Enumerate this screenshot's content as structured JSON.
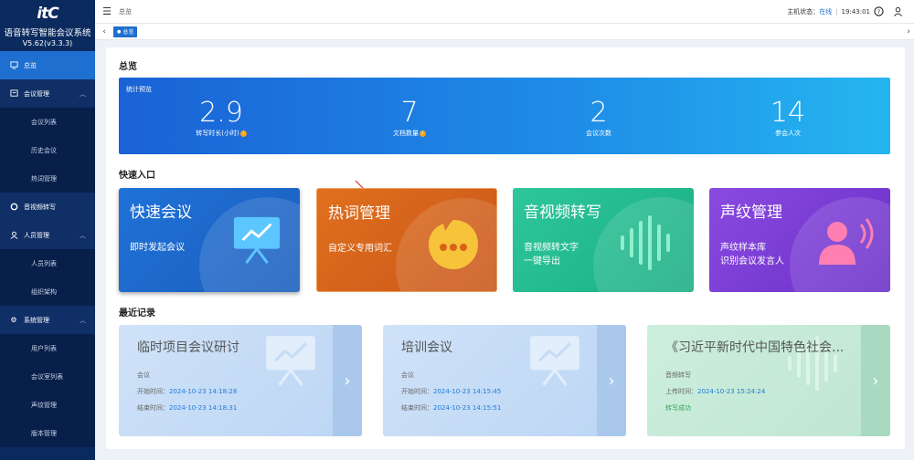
{
  "app": {
    "logo": "itC",
    "title": "语音转写智能会议系统",
    "version": "V5.62(v3.3.3)"
  },
  "sidebar": {
    "items": [
      {
        "label": "总览",
        "icon": "monitor-icon",
        "kind": "active"
      },
      {
        "label": "会议管理",
        "icon": "meeting-icon",
        "kind": "group"
      },
      {
        "label": "会议列表",
        "kind": "sub"
      },
      {
        "label": "历史会议",
        "kind": "sub"
      },
      {
        "label": "热词管理",
        "kind": "sub"
      },
      {
        "label": "音视频转写",
        "icon": "transcribe-icon",
        "kind": "group"
      },
      {
        "label": "人员管理",
        "icon": "user-icon",
        "kind": "group"
      },
      {
        "label": "人员列表",
        "kind": "sub"
      },
      {
        "label": "组织架构",
        "kind": "sub"
      },
      {
        "label": "系统管理",
        "icon": "gear-icon",
        "kind": "group"
      },
      {
        "label": "用户列表",
        "kind": "sub"
      },
      {
        "label": "会议室列表",
        "kind": "sub"
      },
      {
        "label": "声纹管理",
        "kind": "sub"
      },
      {
        "label": "版本管理",
        "kind": "sub"
      }
    ]
  },
  "topbar": {
    "breadcrumb": "总览",
    "status_label": "主机状态：",
    "status_value": "在线",
    "separator": "|",
    "time": "19:43:01"
  },
  "tagbar": {
    "tag": "总览"
  },
  "overview": {
    "title": "总览",
    "stats_label": "统计预览",
    "stats": [
      {
        "value": "2.9",
        "label": "转写时长(小时)"
      },
      {
        "value": "7",
        "label": "文档数量"
      },
      {
        "value": "2",
        "label": "会议次数"
      },
      {
        "value": "14",
        "label": "参会人次"
      }
    ]
  },
  "quick": {
    "title": "快速入口",
    "cards": [
      {
        "title": "快速会议",
        "lines": [
          "即时发起会议"
        ],
        "color": "#1d6fd0"
      },
      {
        "title": "热词管理",
        "lines": [
          "自定义专用词汇"
        ],
        "color": "#d9621a"
      },
      {
        "title": "音视频转写",
        "lines": [
          "音视频转文字",
          "一键导出"
        ],
        "color": "#1fbf8f"
      },
      {
        "title": "声纹管理",
        "lines": [
          "声纹样本库",
          "识别会议发言人"
        ],
        "color": "#7a3fd6"
      }
    ]
  },
  "recent": {
    "title": "最近记录",
    "items": [
      {
        "title": "临时项目会议研讨",
        "kind": "会议",
        "l1k": "开始时间：",
        "l1v": "2024-10-23 14:18:28",
        "l2k": "结束时间：",
        "l2v": "2024-10-23 14:18:31"
      },
      {
        "title": "培训会议",
        "kind": "会议",
        "l1k": "开始时间：",
        "l1v": "2024-10-23 14:15:45",
        "l2k": "结束时间：",
        "l2v": "2024-10-23 14:15:51"
      },
      {
        "title": "《习近平新时代中国特色社会...",
        "kind": "音频转写",
        "l1k": "上传时间：",
        "l1v": "2024-10-23 15:24:24",
        "l2k": "",
        "l2v": "转写成功"
      }
    ]
  }
}
